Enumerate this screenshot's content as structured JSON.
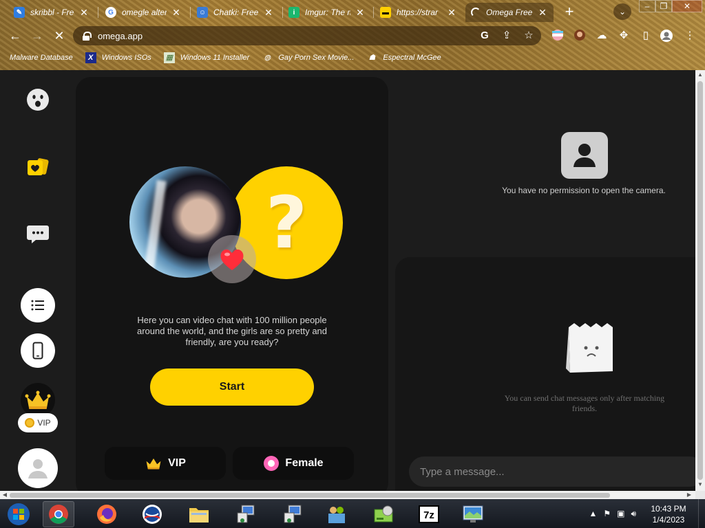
{
  "browser": {
    "tabs": [
      {
        "title": "skribbl - Free",
        "icon": "skribbl-pen-icon"
      },
      {
        "title": "omegle altern",
        "icon": "google-icon"
      },
      {
        "title": "Chatki: Free",
        "icon": "chatki-icon"
      },
      {
        "title": "Imgur: The m",
        "icon": "imgur-icon"
      },
      {
        "title": "https://strar",
        "icon": "sunglasses-icon"
      },
      {
        "title": "Omega Free",
        "icon": "loading-spinner-icon"
      }
    ],
    "url": "omega.app",
    "bookmarks": [
      {
        "label": "Malware Database"
      },
      {
        "label": "Windows ISOs"
      },
      {
        "label": "Windows 11 Installer"
      },
      {
        "label": "Gay Porn Sex Movie..."
      },
      {
        "label": "Espectral McGee"
      }
    ]
  },
  "sidebar": {
    "vip_badge": "VIP"
  },
  "main": {
    "question_mark": "?",
    "pitch": "Here you can video chat with 100 million people around the world, and the girls are so pretty and friendly, are you ready?",
    "start_label": "Start",
    "vip_label": "VIP",
    "female_label": "Female"
  },
  "camera": {
    "message": "You have no permission to open the camera."
  },
  "chat": {
    "empty_message": "You can send chat messages only after matching friends.",
    "input_placeholder": "Type a message..."
  },
  "taskbar": {
    "time": "10:43 PM",
    "date": "1/4/2023",
    "icons": [
      "start-orb-icon",
      "chrome-icon",
      "firefox-icon",
      "obama-logo-icon",
      "file-explorer-icon",
      "network-computer-icon",
      "network-computer-icon",
      "users-icon",
      "disk-cleanup-icon",
      "7zip-icon",
      "remote-desktop-icon"
    ]
  }
}
